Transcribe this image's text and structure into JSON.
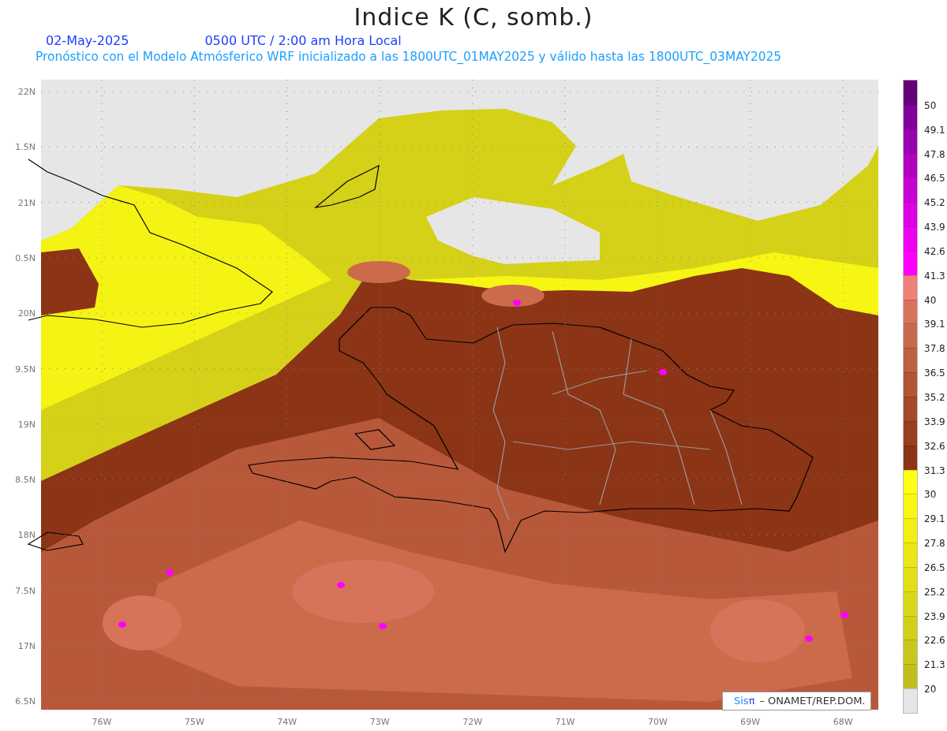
{
  "title": "Indice K (C, somb.)",
  "date": "02-May-2025",
  "time": "0500 UTC / 2:00 am Hora Local",
  "subtitle": "Pronóstico con el Modelo Atmósferico WRF inicializado a las 1800UTC_01MAY2025 y válido hasta las  1800UTC_03MAY2025",
  "lat_labels": [
    "22N",
    "1.5N",
    "21N",
    "0.5N",
    "20N",
    "9.5N",
    "19N",
    "8.5N",
    "18N",
    "7.5N",
    "17N",
    "6.5N"
  ],
  "lon_labels": [
    "76W",
    "75W",
    "74W",
    "73W",
    "72W",
    "71W",
    "70W",
    "69W",
    "68W"
  ],
  "credit": {
    "brand": "Sis",
    "brand_mark": "π",
    "text": "– ONAMET/REP.DOM."
  },
  "colorbar": [
    {
      "color": "#650078",
      "label": "50"
    },
    {
      "color": "#82009c",
      "label": "49.1"
    },
    {
      "color": "#9b00b0",
      "label": "47.8"
    },
    {
      "color": "#b200c2",
      "label": "46.5"
    },
    {
      "color": "#c900d4",
      "label": "45.2"
    },
    {
      "color": "#dc00e2",
      "label": "43.9"
    },
    {
      "color": "#ee00f0",
      "label": "42.6"
    },
    {
      "color": "#ff00ff",
      "label": "41.3"
    },
    {
      "color": "#f0807a",
      "label": "40"
    },
    {
      "color": "#d7735b",
      "label": "39.1"
    },
    {
      "color": "#ca6a4c",
      "label": "37.8"
    },
    {
      "color": "#be5f3f",
      "label": "36.5"
    },
    {
      "color": "#b25533",
      "label": "35.2"
    },
    {
      "color": "#a54a28",
      "label": "33.9"
    },
    {
      "color": "#983f1e",
      "label": "32.6"
    },
    {
      "color": "#8b3416",
      "label": "31.3"
    },
    {
      "color": "#ffff11",
      "label": "30"
    },
    {
      "color": "#f9f712",
      "label": "29.1"
    },
    {
      "color": "#f2ef13",
      "label": "27.8"
    },
    {
      "color": "#eae714",
      "label": "26.5"
    },
    {
      "color": "#e2df16",
      "label": "25.2"
    },
    {
      "color": "#dad718",
      "label": "23.9"
    },
    {
      "color": "#d2cf19",
      "label": "22.6"
    },
    {
      "color": "#cac71b",
      "label": "21.3"
    },
    {
      "color": "#c2be1c",
      "label": "20"
    },
    {
      "color": "#e6e6e6"
    }
  ]
}
